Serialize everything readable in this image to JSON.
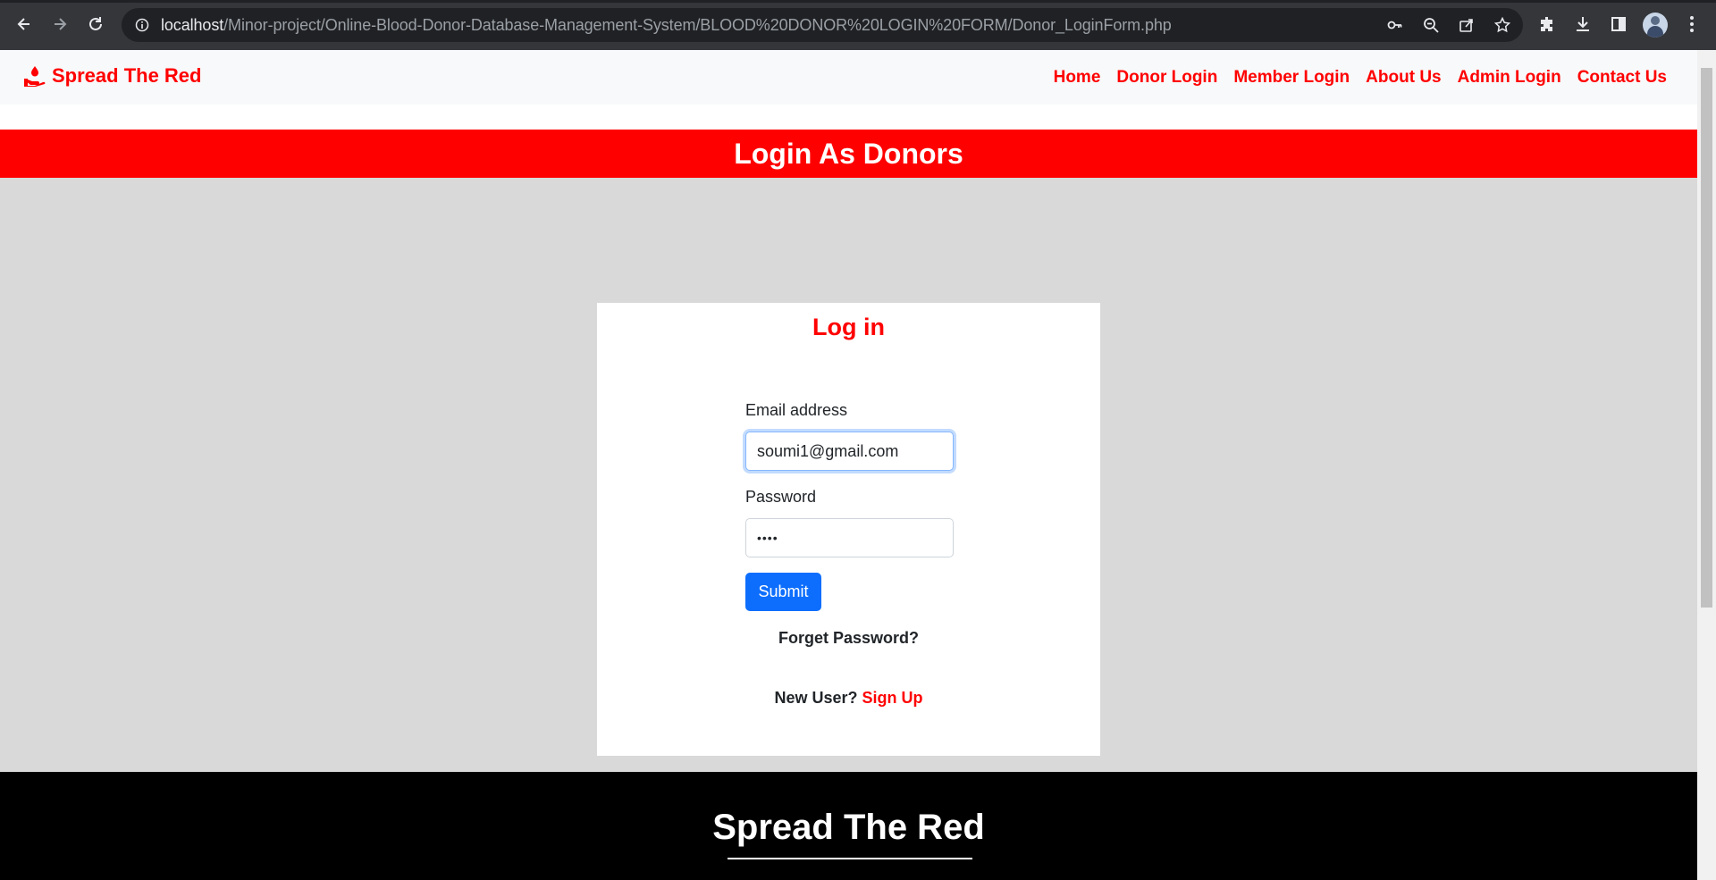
{
  "browser": {
    "url_host": "localhost",
    "url_path": "/Minor-project/Online-Blood-Donor-Database-Management-System/BLOOD%20DONOR%20LOGIN%20FORM/Donor_LoginForm.php"
  },
  "navbar": {
    "brand": "Spread The Red",
    "brand_icon": "hand-drop-icon",
    "links": [
      "Home",
      "Donor Login",
      "Member Login",
      "About Us",
      "Admin Login",
      "Contact Us"
    ]
  },
  "banner": {
    "title": "Login As Donors"
  },
  "login": {
    "title": "Log in",
    "email_label": "Email address",
    "email_value": "soumi1@gmail.com",
    "password_label": "Password",
    "password_value": "••••",
    "submit_label": "Submit",
    "forgot_label": "Forget Password?",
    "new_user_text": "New User?",
    "signup_label": "Sign Up"
  },
  "footer": {
    "title": "Spread The Red"
  },
  "colors": {
    "brand_red": "#ff0000",
    "primary_blue": "#0d6efd",
    "section_grey": "#d9d9d9",
    "footer_black": "#000000"
  }
}
